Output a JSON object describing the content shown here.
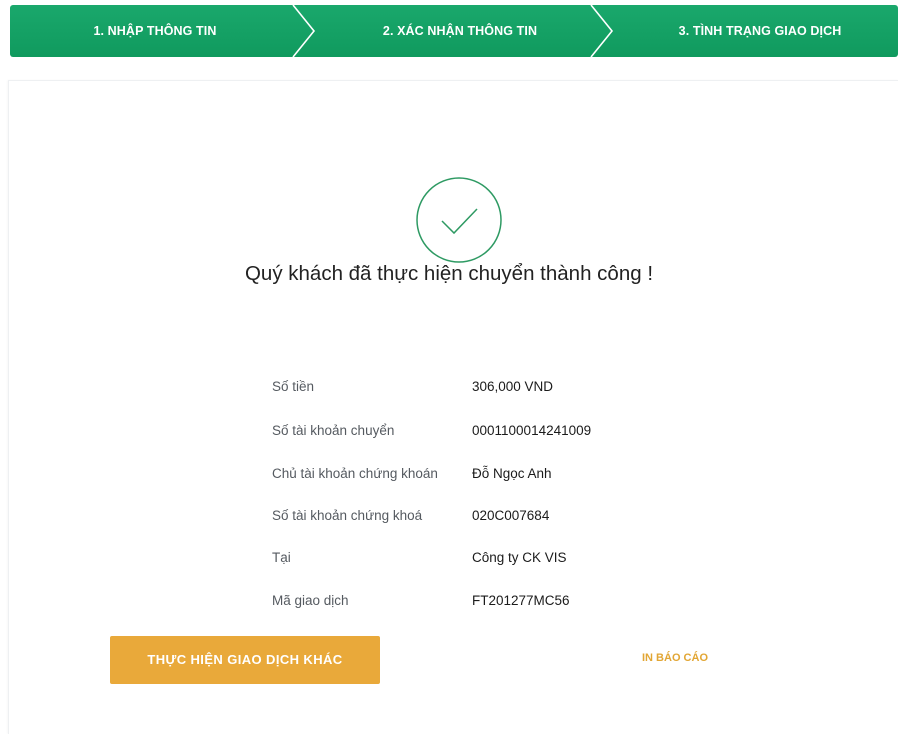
{
  "stepper": {
    "steps": [
      {
        "label": "1. NHẬP THÔNG TIN"
      },
      {
        "label": "2. XÁC NHẬN THÔNG TIN"
      },
      {
        "label": "3. TÌNH TRẠNG GIAO DỊCH"
      }
    ]
  },
  "result": {
    "icon": "check-circle-icon",
    "title": "Quý khách đã thực hiện chuyển thành công !"
  },
  "details": [
    {
      "label": "Số tiền",
      "value": "306,000  VND"
    },
    {
      "label": "Số tài khoản chuyển",
      "value": "0001100014241009"
    },
    {
      "label": "Chủ tài khoản chứng khoán",
      "value": "Đỗ Ngọc Anh"
    },
    {
      "label": "Số tài khoản chứng khoá",
      "value": "020C007684"
    },
    {
      "label": "Tại",
      "value": "Công ty CK VIS"
    },
    {
      "label": "Mã giao dịch",
      "value": "FT201277MC56"
    }
  ],
  "actions": {
    "other_transaction": "THỰC HIỆN GIAO DỊCH KHÁC",
    "print_report": "IN BÁO CÁO"
  },
  "colors": {
    "header_green": "#109a5e",
    "success_green": "#2e9a63",
    "button_orange": "#e9a93a"
  }
}
